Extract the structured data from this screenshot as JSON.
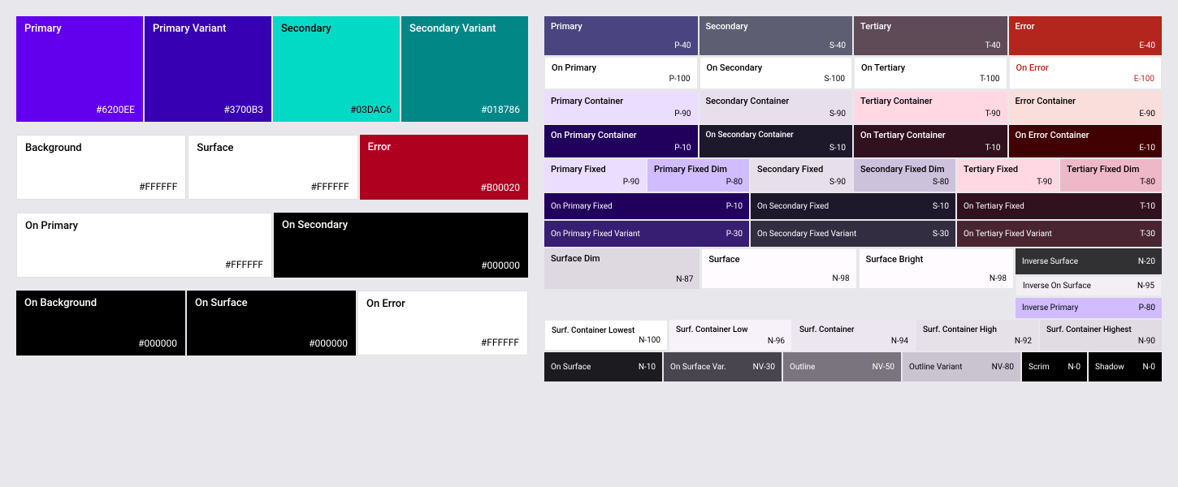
{
  "left": {
    "primaryRow": [
      {
        "name": "Primary",
        "hex": "#6200EE",
        "bg": "#6200EE",
        "color": "#FFFFFF"
      },
      {
        "name": "Primary Variant",
        "hex": "#3700B3",
        "bg": "#3700B3",
        "color": "#FFFFFF"
      },
      {
        "name": "Secondary",
        "hex": "#03DAC6",
        "bg": "#03DAC6",
        "color": "#000000"
      },
      {
        "name": "Secondary Variant",
        "hex": "#018786",
        "bg": "#018786",
        "color": "#FFFFFF"
      }
    ],
    "neutralRow": [
      {
        "name": "Background",
        "hex": "#FFFFFF",
        "bg": "#FFFFFF",
        "color": "#000000"
      },
      {
        "name": "Surface",
        "hex": "#FFFFFF",
        "bg": "#FFFFFF",
        "color": "#000000"
      },
      {
        "name": "Error",
        "hex": "#B00020",
        "bg": "#B00020",
        "color": "#FFFFFF"
      }
    ],
    "onRow1": [
      {
        "name": "On Primary",
        "hex": "#FFFFFF",
        "bg": "#FFFFFF",
        "color": "#000000"
      },
      {
        "name": "On Secondary",
        "hex": "#000000",
        "bg": "#000000",
        "color": "#FFFFFF"
      }
    ],
    "onRow2": [
      {
        "name": "On Background",
        "hex": "#000000",
        "bg": "#000000",
        "color": "#FFFFFF"
      },
      {
        "name": "On Surface",
        "hex": "#000000",
        "bg": "#000000",
        "color": "#FFFFFF"
      },
      {
        "name": "On Error",
        "hex": "#FFFFFF",
        "bg": "#FFFFFF",
        "color": "#000000"
      }
    ]
  },
  "right": {
    "row1": [
      {
        "name": "Primary",
        "code": "P-40",
        "bg": "#4a4580",
        "color": "#FFFFFF",
        "flex": 1
      },
      {
        "name": "Secondary",
        "code": "S-40",
        "bg": "#5e5e72",
        "color": "#FFFFFF",
        "flex": 1
      },
      {
        "name": "Tertiary",
        "code": "T-40",
        "bg": "#5f4a58",
        "color": "#FFFFFF",
        "flex": 1
      },
      {
        "name": "Error",
        "code": "E-40",
        "bg": "#b3261e",
        "color": "#FFFFFF",
        "flex": 1
      }
    ],
    "row2": [
      {
        "name": "On Primary",
        "code": "P-100",
        "bg": "#FFFFFF",
        "color": "#000000",
        "flex": 1
      },
      {
        "name": "On Secondary",
        "code": "S-100",
        "bg": "#FFFFFF",
        "color": "#000000",
        "flex": 1
      },
      {
        "name": "On Tertiary",
        "code": "T-100",
        "bg": "#FFFFFF",
        "color": "#000000",
        "flex": 1
      },
      {
        "name": "On Error",
        "code": "E-100",
        "bg": "#FFFFFF",
        "color": "#b3261e",
        "flex": 1
      }
    ],
    "row3": [
      {
        "name": "Primary Container",
        "code": "P-90",
        "bg": "#eaddff",
        "color": "#000000",
        "flex": 1
      },
      {
        "name": "Secondary Container",
        "code": "S-90",
        "bg": "#e7e0ec",
        "color": "#000000",
        "flex": 1
      },
      {
        "name": "Tertiary Container",
        "code": "T-90",
        "bg": "#ffd8e4",
        "color": "#000000",
        "flex": 1
      },
      {
        "name": "Error Container",
        "code": "E-90",
        "bg": "#f9dedc",
        "color": "#000000",
        "flex": 1
      }
    ],
    "row4": [
      {
        "name": "On Primary Container",
        "code": "P-10",
        "bg": "#21005d",
        "color": "#FFFFFF",
        "flex": 1
      },
      {
        "name": "On Secondary Container",
        "code": "S-10",
        "bg": "#1d192b",
        "color": "#FFFFFF",
        "flex": 1
      },
      {
        "name": "On Tertiary Container",
        "code": "T-10",
        "bg": "#31111d",
        "color": "#FFFFFF",
        "flex": 1
      },
      {
        "name": "On Error Container",
        "code": "E-10",
        "bg": "#410002",
        "color": "#FFFFFF",
        "flex": 1
      }
    ],
    "row5": [
      {
        "name": "Primary Fixed",
        "code": "P-90",
        "bg": "#eaddff",
        "color": "#000000",
        "flex": 1
      },
      {
        "name": "Primary Fixed Dim",
        "code": "P-80",
        "bg": "#d0bcff",
        "color": "#000000",
        "flex": 1
      },
      {
        "name": "Secondary Fixed",
        "code": "S-90",
        "bg": "#e7e0ec",
        "color": "#000000",
        "flex": 1
      },
      {
        "name": "Secondary Fixed Dim",
        "code": "S-80",
        "bg": "#ccc2dc",
        "color": "#000000",
        "flex": 1
      },
      {
        "name": "Tertiary Fixed",
        "code": "T-90",
        "bg": "#ffd8e4",
        "color": "#000000",
        "flex": 1
      },
      {
        "name": "Tertiary Fixed Dim",
        "code": "T-80",
        "bg": "#efb8c8",
        "color": "#000000",
        "flex": 1
      }
    ],
    "row6": [
      {
        "name": "On Primary Fixed",
        "code": "P-10",
        "bg": "#21005d",
        "color": "#FFFFFF",
        "flex": 1
      },
      {
        "name": "On Secondary Fixed",
        "code": "S-10",
        "bg": "#1d192b",
        "color": "#FFFFFF",
        "flex": 1
      },
      {
        "name": "On Tertiary Fixed",
        "code": "T-10",
        "bg": "#31111d",
        "color": "#FFFFFF",
        "flex": 1
      }
    ],
    "row7": [
      {
        "name": "On Primary Fixed Variant",
        "code": "P-30",
        "bg": "#381e72",
        "color": "#FFFFFF",
        "flex": 1
      },
      {
        "name": "On Secondary Fixed Variant",
        "code": "S-30",
        "bg": "#332d41",
        "color": "#FFFFFF",
        "flex": 1
      },
      {
        "name": "On Tertiary Fixed Variant",
        "code": "T-30",
        "bg": "#492532",
        "color": "#FFFFFF",
        "flex": 1
      }
    ],
    "row8": [
      {
        "name": "Surface Dim",
        "code": "N-87",
        "bg": "#ded8e1",
        "color": "#000000",
        "flex": 1
      },
      {
        "name": "Surface",
        "code": "N-98",
        "bg": "#fffbfe",
        "color": "#000000",
        "flex": 1
      },
      {
        "name": "Surface Bright",
        "code": "N-98",
        "bg": "#fffbfe",
        "color": "#000000",
        "flex": 1
      },
      {
        "name": "Inverse Surface",
        "code": "N-20",
        "bg": "#313033",
        "color": "#FFFFFF",
        "flex": 0.8
      }
    ],
    "row8b": [
      {
        "name": "Inverse On Surface",
        "code": "N-95",
        "bg": "#f4eff4",
        "color": "#000000",
        "flex": 1
      },
      {
        "name": "Inverse Primary",
        "code": "P-80",
        "bg": "#d0bcff",
        "color": "#000000",
        "flex": 1
      }
    ],
    "row9": [
      {
        "name": "Surf. Container Lowest",
        "code": "N-100",
        "bg": "#FFFFFF",
        "color": "#000000",
        "flex": 1
      },
      {
        "name": "Surf. Container Low",
        "code": "N-96",
        "bg": "#f7f2fa",
        "color": "#000000",
        "flex": 1
      },
      {
        "name": "Surf. Container",
        "code": "N-94",
        "bg": "#ece6f0",
        "color": "#000000",
        "flex": 1
      },
      {
        "name": "Surf. Container High",
        "code": "N-92",
        "bg": "#e6e0e9",
        "color": "#000000",
        "flex": 1
      },
      {
        "name": "Surf. Container Highest",
        "code": "N-90",
        "bg": "#e1dbe4",
        "color": "#000000",
        "flex": 1
      }
    ],
    "row10": [
      {
        "name": "On Surface",
        "code": "N-10",
        "bg": "#1c1b1f",
        "color": "#FFFFFF",
        "flex": 1
      },
      {
        "name": "On Surface Var.",
        "code": "NV-30",
        "bg": "#49454f",
        "color": "#FFFFFF",
        "flex": 1
      },
      {
        "name": "Outline",
        "code": "NV-50",
        "bg": "#79747e",
        "color": "#FFFFFF",
        "flex": 1
      },
      {
        "name": "Outline Variant",
        "code": "NV-80",
        "bg": "#cac4d0",
        "color": "#000000",
        "flex": 1
      },
      {
        "name": "Scrim",
        "code": "N-0",
        "bg": "#000000",
        "color": "#FFFFFF",
        "flex": 0.6
      },
      {
        "name": "Shadow",
        "code": "N-0",
        "bg": "#000000",
        "color": "#FFFFFF",
        "flex": 0.6
      }
    ]
  }
}
